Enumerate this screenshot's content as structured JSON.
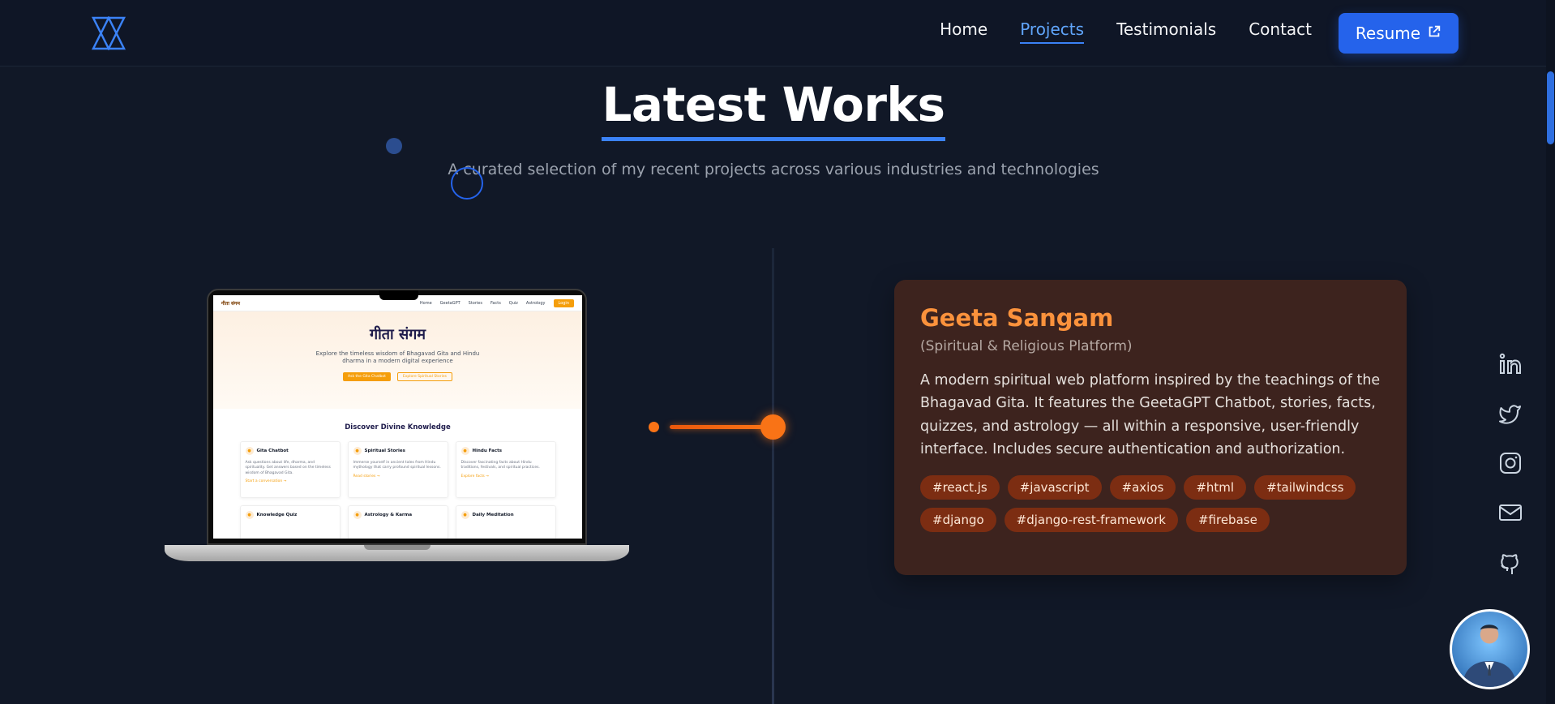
{
  "nav": {
    "links": [
      "Home",
      "Projects",
      "Testimonials",
      "Contact"
    ],
    "active_index": 1,
    "resume_label": "Resume"
  },
  "section": {
    "title": "Latest Works",
    "subtitle": "A curated selection of my recent projects across various industries and technologies"
  },
  "preview": {
    "logo": "गीता संगम",
    "nav_links": [
      "Home",
      "GeetaGPT",
      "Stories",
      "Facts",
      "Quiz",
      "Astrology"
    ],
    "login": "Login",
    "hero_title": "गीता संगम",
    "hero_desc": "Explore the timeless wisdom of Bhagavad Gita and Hindu dharma in a modern digital experience",
    "btn_primary": "Ask the Gita Chatbot",
    "btn_secondary": "Explore Spiritual Stories",
    "section_title": "Discover Divine Knowledge",
    "cards": [
      {
        "title": "Gita Chatbot",
        "desc": "Ask questions about life, dharma, and spirituality. Get answers based on the timeless wisdom of Bhagavad Gita.",
        "link": "Start a conversation →"
      },
      {
        "title": "Spiritual Stories",
        "desc": "Immerse yourself in ancient tales from Hindu mythology that carry profound spiritual lessons.",
        "link": "Read stories →"
      },
      {
        "title": "Hindu Facts",
        "desc": "Discover fascinating facts about Hindu traditions, festivals, and spiritual practices.",
        "link": "Explore facts →"
      },
      {
        "title": "Knowledge Quiz",
        "desc": "",
        "link": ""
      },
      {
        "title": "Astrology & Karma",
        "desc": "",
        "link": ""
      },
      {
        "title": "Daily Meditation",
        "desc": "",
        "link": ""
      }
    ]
  },
  "project": {
    "title": "Geeta Sangam",
    "category": "(Spiritual & Religious Platform)",
    "description": "A modern spiritual web platform inspired by the teachings of the Bhagavad Gita. It features the GeetaGPT Chatbot, stories, facts, quizzes, and astrology — all within a responsive, user-friendly interface. Includes secure authentication and authorization.",
    "tags": [
      "#react.js",
      "#javascript",
      "#axios",
      "#html",
      "#tailwindcss",
      "#django",
      "#django-rest-framework",
      "#firebase"
    ]
  },
  "social": [
    "linkedin-icon",
    "twitter-icon",
    "instagram-icon",
    "mail-icon",
    "github-icon"
  ],
  "colors": {
    "background": "#111827",
    "accent_blue": "#2563eb",
    "accent_orange": "#f97316",
    "card_bg": "#3d231e"
  }
}
